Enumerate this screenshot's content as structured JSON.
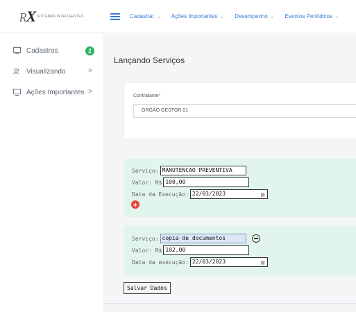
{
  "app": {
    "logo_text": "SISTEMAS INTELIGENTES"
  },
  "sidebar": {
    "items": [
      {
        "label": "Cadastros",
        "icon": "monitor-icon",
        "badge": "2"
      },
      {
        "label": "Visualizando",
        "icon": "users-icon",
        "arrow": ">"
      },
      {
        "label": "Ações Importantes",
        "icon": "monitor-icon",
        "arrow": ">"
      }
    ]
  },
  "topnav": {
    "items": [
      {
        "label": "Cadastrar",
        "caret": "⌄"
      },
      {
        "label": "Ações Importantes",
        "caret": "⌄"
      },
      {
        "label": "Desempenho",
        "caret": "⌄"
      },
      {
        "label": "Eventos Periódicos",
        "caret": "⌄"
      }
    ]
  },
  "page": {
    "title": "Lançando Serviços"
  },
  "contratante": {
    "label": "Contratante",
    "required_mark": "*",
    "value": "ORGAO GESTOR 01"
  },
  "services": [
    {
      "servico_label": "Serviço:",
      "servico_value": "MANUTENCAO PREVENTIVA",
      "valor_label": "Valor: R$",
      "valor_value": "100,00",
      "data_label": "Data da Execução:",
      "data_value": "22/03/2023"
    },
    {
      "servico_label": "Serviço:",
      "servico_value": "copia de documentos",
      "valor_label": "Valor: R$",
      "valor_value": "102,00",
      "data_label": "Data da execução:",
      "data_value": "22/03/2023"
    }
  ],
  "actions": {
    "save_label": "Salvar Dados"
  },
  "colors": {
    "accent": "#3a7bd5",
    "badge": "#28b463",
    "service_bg": "#e2f5ec",
    "add_button": "#e8403a"
  }
}
